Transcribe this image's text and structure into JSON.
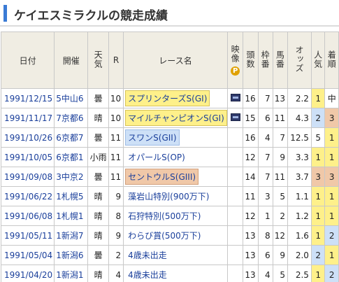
{
  "page": {
    "title": "ケイエスミラクルの競走成績"
  },
  "columns": {
    "date": "日付",
    "venue": "開催",
    "weather": "天気",
    "round": "R",
    "race": "レース名",
    "video": "映像",
    "video_badge": "P",
    "field_size": "頭数",
    "frame": "枠番",
    "horse_no": "馬番",
    "odds": "オッズ",
    "popularity": "人気",
    "finish": "着順"
  },
  "rows": [
    {
      "date": "1991/12/15",
      "venue": "5中山6",
      "weather": "曇",
      "round": "10",
      "race": "スプリンターズS(GI)",
      "grade": "g1",
      "video": true,
      "field": "16",
      "frame": "7",
      "horse": "13",
      "odds": "2.2",
      "pop": "1",
      "finish": "中"
    },
    {
      "date": "1991/11/17",
      "venue": "7京都6",
      "weather": "晴",
      "round": "10",
      "race": "マイルチャンピオンS(GI)",
      "grade": "g1",
      "video": true,
      "field": "15",
      "frame": "6",
      "horse": "11",
      "odds": "4.3",
      "pop": "2",
      "finish": "3"
    },
    {
      "date": "1991/10/26",
      "venue": "6京都7",
      "weather": "曇",
      "round": "11",
      "race": "スワンS(GII)",
      "grade": "g2",
      "video": false,
      "field": "16",
      "frame": "4",
      "horse": "7",
      "odds": "12.5",
      "pop": "5",
      "finish": "1"
    },
    {
      "date": "1991/10/05",
      "venue": "6京都1",
      "weather": "小雨",
      "round": "11",
      "race": "オパールS(OP)",
      "grade": "",
      "video": false,
      "field": "12",
      "frame": "7",
      "horse": "9",
      "odds": "3.3",
      "pop": "1",
      "finish": "1"
    },
    {
      "date": "1991/09/08",
      "venue": "3中京2",
      "weather": "曇",
      "round": "11",
      "race": "セントウルS(GIII)",
      "grade": "g3",
      "video": false,
      "field": "14",
      "frame": "7",
      "horse": "11",
      "odds": "3.7",
      "pop": "3",
      "finish": "3"
    },
    {
      "date": "1991/06/22",
      "venue": "1札幌5",
      "weather": "晴",
      "round": "9",
      "race": "藻岩山特別(900万下)",
      "grade": "",
      "video": false,
      "field": "11",
      "frame": "3",
      "horse": "5",
      "odds": "1.1",
      "pop": "1",
      "finish": "1"
    },
    {
      "date": "1991/06/08",
      "venue": "1札幌1",
      "weather": "晴",
      "round": "8",
      "race": "石狩特別(500万下)",
      "grade": "",
      "video": false,
      "field": "12",
      "frame": "1",
      "horse": "2",
      "odds": "1.2",
      "pop": "1",
      "finish": "1"
    },
    {
      "date": "1991/05/11",
      "venue": "1新潟7",
      "weather": "晴",
      "round": "9",
      "race": "わらび賞(500万下)",
      "grade": "",
      "video": false,
      "field": "13",
      "frame": "8",
      "horse": "12",
      "odds": "1.6",
      "pop": "1",
      "finish": "2"
    },
    {
      "date": "1991/05/04",
      "venue": "1新潟6",
      "weather": "曇",
      "round": "2",
      "race": "4歳未出走",
      "grade": "",
      "video": false,
      "field": "13",
      "frame": "6",
      "horse": "9",
      "odds": "2.0",
      "pop": "2",
      "finish": "1"
    },
    {
      "date": "1991/04/20",
      "venue": "1新潟1",
      "weather": "晴",
      "round": "4",
      "race": "4歳未出走",
      "grade": "",
      "video": false,
      "field": "13",
      "frame": "4",
      "horse": "5",
      "odds": "2.5",
      "pop": "1",
      "finish": "2"
    }
  ],
  "colors": {
    "accent": "#3a7bd5",
    "header_bg": "#f0ede3",
    "g1": "#fef08a",
    "g2": "#cde0f7",
    "g3": "#f0c8a8",
    "link": "#1a3f9b"
  }
}
